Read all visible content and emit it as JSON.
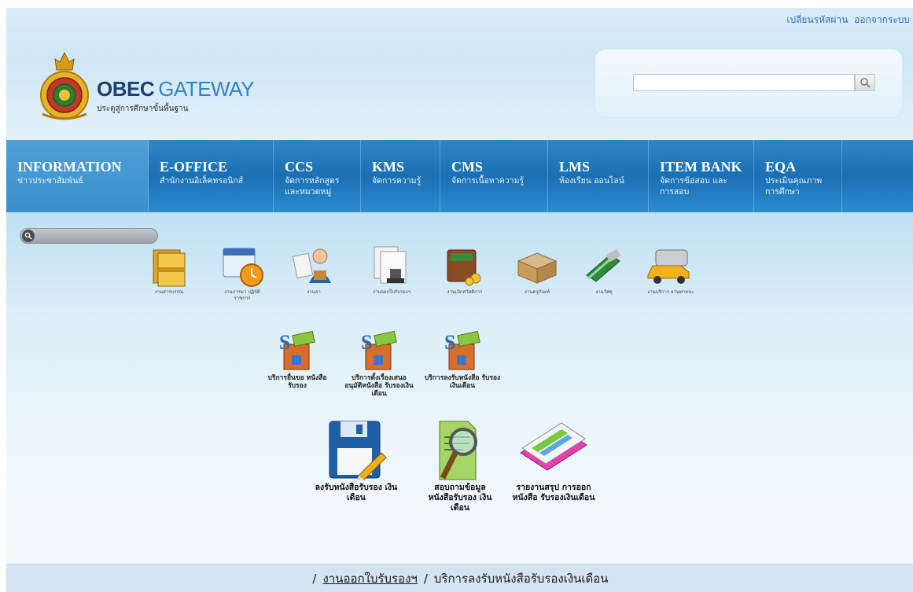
{
  "top_links": {
    "change_password": "เปลี่ยนรหัสผ่าน",
    "logout": "ออกจากระบบ"
  },
  "brand": {
    "name_part1": "OBEC",
    "name_part2": "GATEWAY",
    "subtitle": "ประตูสู่การศึกษาขั้นพื้นฐาน"
  },
  "search": {
    "value": "",
    "button_icon": "magnifier-icon"
  },
  "nav": {
    "items": [
      {
        "title": "INFORMATION",
        "sub": "ข่าวประชาสัมพันธ์",
        "active": true
      },
      {
        "title": "E-OFFICE",
        "sub": "สำนักงานอิเล็คทรอนิกส์"
      },
      {
        "title": "CCS",
        "sub": "จัดการหลักสูตร และหมวดหมู่"
      },
      {
        "title": "KMS",
        "sub": "จัดการความรู้"
      },
      {
        "title": "CMS",
        "sub": "จัดการเนื้อหาความรู้"
      },
      {
        "title": "LMS",
        "sub": "ห้องเรียน ออนไลน์"
      },
      {
        "title": "ITEM BANK",
        "sub": "จัดการข้อสอบ และการสอบ"
      },
      {
        "title": "EQA",
        "sub": "ประเมินคุณภาพ การศึกษา"
      }
    ]
  },
  "modules": [
    {
      "label": "งานสารบรรณ",
      "icon": "folders-icon"
    },
    {
      "label": "งานการมา ปฏิบัติราชการ",
      "icon": "calendar-clock-icon"
    },
    {
      "label": "งานลา",
      "icon": "businessman-icon"
    },
    {
      "label": "งานออกใบรับรองฯ",
      "icon": "certificate-stamp-icon"
    },
    {
      "label": "งานเบิกสวัสดิการ",
      "icon": "wallet-coins-icon"
    },
    {
      "label": "งานครุภัณฑ์",
      "icon": "open-box-icon"
    },
    {
      "label": "งานวัสดุ",
      "icon": "stapler-icon"
    },
    {
      "label": "งานบริการ ยานพาหนะ",
      "icon": "vehicles-icon"
    }
  ],
  "services": [
    {
      "label": "บริการยื่นขอ หนังสือรับรอง",
      "icon": "eoffice-package-icon"
    },
    {
      "label": "บริการตั้งเรื่องเสนอ อนุมัติหนังสือ รับรองเงินเดือน",
      "icon": "eoffice-package-icon"
    },
    {
      "label": "บริการลงรับหนังสือ รับรองเงินเดือน",
      "icon": "eoffice-package-icon"
    }
  ],
  "actions": [
    {
      "label": "ลงรับหนังสือรับรอง เงินเดือน",
      "icon": "save-disk-icon"
    },
    {
      "label": "สอบถามข้อมูล หนังสือรับรอง เงินเดือน",
      "icon": "document-search-icon"
    },
    {
      "label": "รายงานสรุป การออกหนังสือ รับรองเงินเดือน",
      "icon": "report-stack-icon"
    }
  ],
  "breadcrumb": {
    "sep": "/",
    "link": "งานออกใบรับรองฯ",
    "current": "บริการลงรับหนังสือรับรองเงินเดือน"
  },
  "colors": {
    "nav_blue": "#1b6fb3",
    "header_bg": "#d9ecf8",
    "link_blue": "#2f6fa8",
    "footer_bg": "#d6e4f2"
  }
}
